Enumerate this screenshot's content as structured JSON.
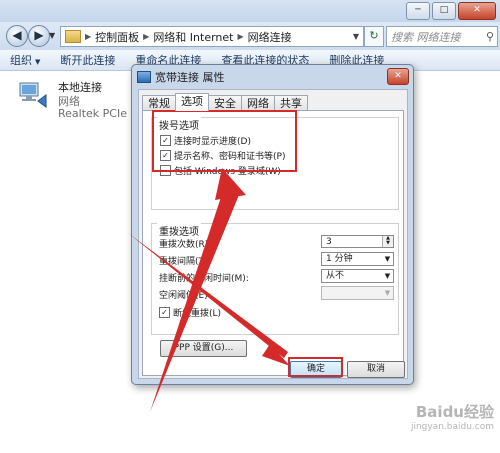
{
  "window": {
    "min_glyph": "─",
    "max_glyph": "□",
    "close_glyph": "✕"
  },
  "addressbar": {
    "back_glyph": "◀",
    "forward_glyph": "▶",
    "crumbs": [
      "控制面板",
      "网络和 Internet",
      "网络连接"
    ],
    "separator": "▶",
    "search_placeholder": "搜索 网络连接",
    "refresh_glyph": "↻"
  },
  "toolbar": {
    "items": [
      "组织",
      "断开此连接",
      "重命名此连接",
      "查看此连接的状态",
      "删除此连接"
    ]
  },
  "connection": {
    "name": "本地连接",
    "type": "网络",
    "device": "Realtek PCIe GB"
  },
  "dialog": {
    "title": "宽带连接 属性",
    "tabs": [
      "常规",
      "选项",
      "安全",
      "网络",
      "共享"
    ],
    "active_tab": "选项",
    "dial_group": {
      "label": "拨号选项",
      "options": [
        {
          "label": "连接时显示进度(D)",
          "checked": true
        },
        {
          "label": "提示名称、密码和证书等(P)",
          "checked": true
        },
        {
          "label": "包括 Windows 登录域(W)",
          "checked": false
        }
      ]
    },
    "redial_group": {
      "label": "重拨选项",
      "redial_attempts_label": "重拨次数(R):",
      "redial_attempts_value": "3",
      "redial_interval_label": "重拨间隔(T):",
      "redial_interval_value": "1 分钟",
      "idle_hangup_label": "挂断前的空闲时间(M):",
      "idle_hangup_value": "从不",
      "idle_threshold_label": "空闲阈值(E):",
      "idle_threshold_value": "",
      "reconnect_label": "断线重拨(L)",
      "reconnect_checked": true
    },
    "ppp_button": "PPP 设置(G)...",
    "ok_button": "确定",
    "cancel_button": "取消"
  },
  "watermark": {
    "brand": "Baidu经验",
    "url": "jingyan.baidu.com"
  },
  "colors": {
    "annotation_red": "#d42a2a",
    "dialog_frame": "#c8d7ea"
  }
}
